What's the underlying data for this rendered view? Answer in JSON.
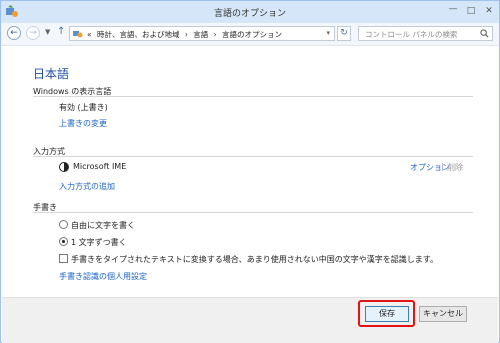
{
  "window": {
    "title": "言語のオプション"
  },
  "address_bar": {
    "overflow": "«",
    "breadcrumbs": [
      "時計、言語、および地域",
      "›",
      "言語",
      "›",
      "言語のオプション"
    ],
    "search_placeholder": "コントロール パネルの検索"
  },
  "main": {
    "heading": "日本語",
    "display_language": {
      "title": "Windows の表示言語",
      "status": "有効 (上書き)",
      "change_link": "上書きの変更"
    },
    "input_method": {
      "title": "入力方式",
      "items": [
        {
          "name": "Microsoft IME",
          "options_link": "オプション",
          "separator": "|",
          "remove_link": "削除"
        }
      ],
      "add_link": "入力方式の追加"
    },
    "handwriting": {
      "title": "手書き",
      "options": [
        {
          "label": "自由に文字を書く",
          "selected": false
        },
        {
          "label": "1 文字ずつ書く",
          "selected": true
        }
      ],
      "checkbox_label": "手書きをタイプされたテキストに変換する場合、あまり使用されない中国の文字や漢字を認識します。",
      "checkbox_checked": false,
      "personalize_link": "手書き認識の個人用設定"
    }
  },
  "footer": {
    "save_label": "保存",
    "cancel_label": "キャンセル"
  },
  "colors": {
    "heading": "#1e4e9c",
    "link": "#1b63c6",
    "highlight": "#e01515",
    "titlebar": "#d4e6f7"
  }
}
